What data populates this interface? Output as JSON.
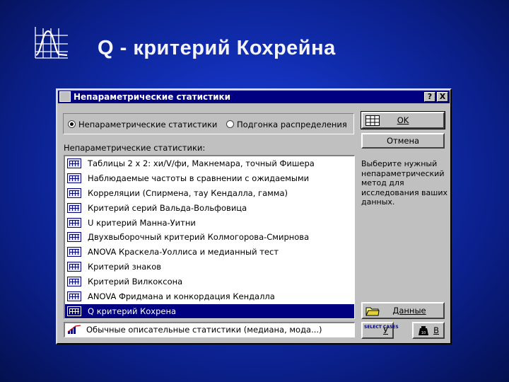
{
  "slide": {
    "title": "Q - критерий Кохрейна"
  },
  "dialog": {
    "title": "Непараметрические статистики",
    "help_label": "?",
    "close_label": "X",
    "radio_options": [
      {
        "label": "Непараметрические статистики",
        "selected": true
      },
      {
        "label": "Подгонка распределения",
        "selected": false
      }
    ],
    "list_label": "Непараметрические статистики:",
    "items": [
      {
        "label": "Таблицы 2 x 2:  хи/V/фи, Макнемара, точный Фишера",
        "icon": "table-grid-icon"
      },
      {
        "label": "Наблюдаемые частоты в сравнении с ожидаемыми",
        "icon": "frequency-icon"
      },
      {
        "label": "Корреляции (Спирмена, тау Кендалла, гамма)",
        "icon": "correlation-icon"
      },
      {
        "label": "Критерий серий Вальда-Вольфовица",
        "icon": "runs-test-icon"
      },
      {
        "label": "U критерий Манна-Уитни",
        "icon": "mann-whitney-icon"
      },
      {
        "label": "Двухвыборочный критерий Колмогорова-Смирнова",
        "icon": "ks-test-icon"
      },
      {
        "label": "ANOVA Краскела-Уоллиса и медианный тест",
        "icon": "kruskal-icon"
      },
      {
        "label": "Критерий знаков",
        "icon": "sign-test-icon"
      },
      {
        "label": "Критерий Вилкоксона",
        "icon": "wilcoxon-icon"
      },
      {
        "label": "ANOVA Фридмана и конкордация Кендалла",
        "icon": "friedman-icon"
      },
      {
        "label": "Q критерий Кохрена",
        "icon": "cochran-icon",
        "selected": true
      }
    ],
    "extra_item": {
      "label": "Обычные описательные статистики (медиана, мода...)",
      "icon": "descriptive-stats-icon"
    },
    "buttons": {
      "ok": "OK",
      "cancel": "Отмена",
      "data": "Данные",
      "select_cases_icon": "SELECT CASES",
      "select_cases": "У",
      "weight": "В"
    },
    "hint": "Выберите нужный непараметрический метод для исследования ваших данных.",
    "colors": {
      "titlebar": "#000080",
      "selection": "#000080",
      "face": "#c0c0c0"
    }
  }
}
